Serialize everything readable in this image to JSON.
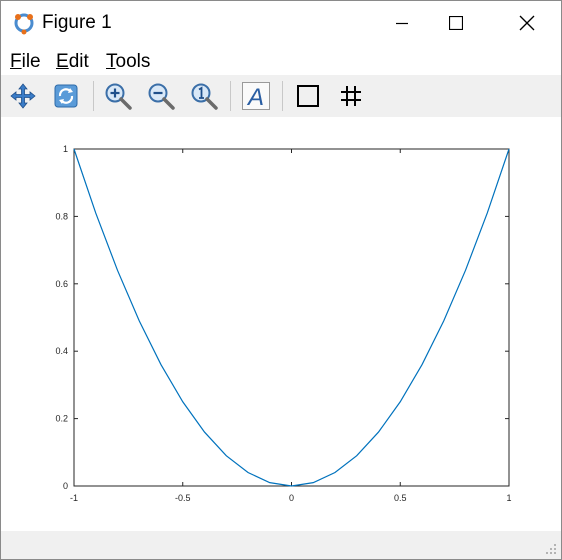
{
  "window": {
    "title": "Figure 1"
  },
  "menu": {
    "file": {
      "accel": "F",
      "rest": "ile"
    },
    "edit": {
      "accel": "E",
      "rest": "dit"
    },
    "tools": {
      "accel": "T",
      "rest": "ools"
    }
  },
  "toolbar": {
    "buttons": [
      "pan",
      "rotate",
      "zoom-in",
      "zoom-out",
      "zoom-reset",
      "insert-text",
      "toggle-box",
      "toggle-grid"
    ],
    "text_button_glyph": "A"
  },
  "colors": {
    "line": "#0072bd",
    "toolbar_bg": "#f0f0f0",
    "axes": "#262626"
  },
  "chart_data": {
    "type": "line",
    "title": "",
    "xlabel": "",
    "ylabel": "",
    "xlim": [
      -1,
      1
    ],
    "ylim": [
      0,
      1
    ],
    "grid": false,
    "box": true,
    "xticks": [
      -1,
      -0.5,
      0,
      0.5,
      1
    ],
    "xticklabels": [
      "-1",
      "-0.5",
      "0",
      "0.5",
      "1"
    ],
    "yticks": [
      0,
      0.2,
      0.4,
      0.6,
      0.8,
      1
    ],
    "yticklabels": [
      "0",
      "0.2",
      "0.4",
      "0.6",
      "0.8",
      "1"
    ],
    "series": [
      {
        "x": [
          -1,
          -0.9,
          -0.8,
          -0.7,
          -0.6,
          -0.5,
          -0.4,
          -0.3,
          -0.2,
          -0.1,
          0,
          0.1,
          0.2,
          0.3,
          0.4,
          0.5,
          0.6,
          0.7,
          0.8,
          0.9,
          1
        ],
        "y": [
          1,
          0.81,
          0.64,
          0.49,
          0.36,
          0.25,
          0.16,
          0.09,
          0.04,
          0.01,
          0,
          0.01,
          0.04,
          0.09,
          0.16,
          0.25,
          0.36,
          0.49,
          0.64,
          0.81,
          1
        ]
      }
    ]
  }
}
